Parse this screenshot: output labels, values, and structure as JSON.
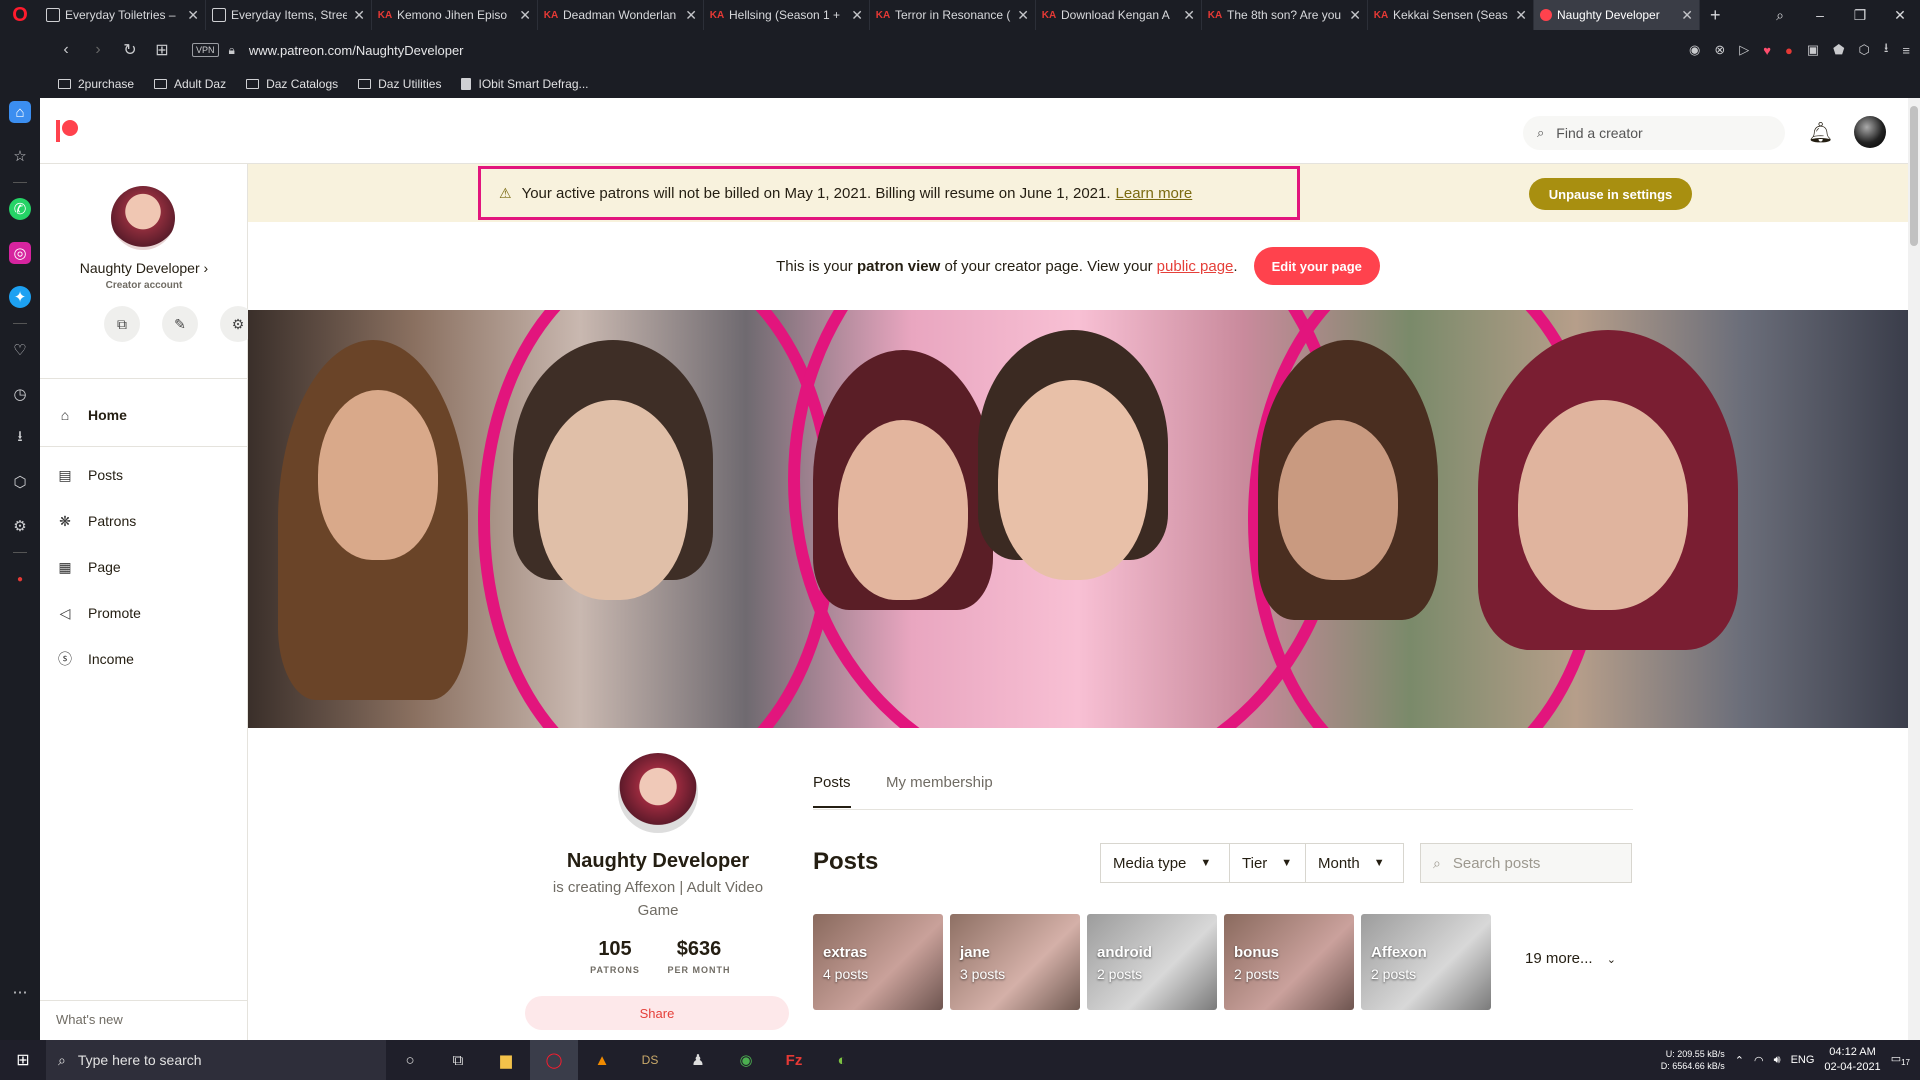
{
  "browser": {
    "tabs": [
      {
        "title": "Everyday Toiletries – ",
        "icon": "box-icon"
      },
      {
        "title": "Everyday Items, Stree",
        "icon": "box-icon"
      },
      {
        "title": "Kemono Jihen Episo",
        "icon": "ka-icon"
      },
      {
        "title": "Deadman Wonderlan",
        "icon": "ka-icon"
      },
      {
        "title": "Hellsing (Season 1 +",
        "icon": "ka-icon"
      },
      {
        "title": "Terror in Resonance (",
        "icon": "ka-icon"
      },
      {
        "title": "Download Kengan A",
        "icon": "ka-icon"
      },
      {
        "title": "The 8th son? Are you",
        "icon": "ka-icon"
      },
      {
        "title": "Kekkai Sensen (Seas",
        "icon": "ka-icon"
      },
      {
        "title": "Naughty Developer",
        "icon": "patreon-icon",
        "active": true
      }
    ],
    "url": "www.patreon.com/NaughtyDeveloper",
    "vpn": "VPN",
    "bookmarks": [
      "2purchase",
      "Adult Daz",
      "Daz Catalogs",
      "Daz Utilities",
      "IObit Smart Defrag..."
    ]
  },
  "patreon": {
    "search_placeholder": "Find a creator",
    "brand_color": "#ff424d",
    "creator": {
      "name": "Naughty Developer",
      "chevron": "›",
      "account_type": "Creator account"
    },
    "nav": [
      {
        "label": "Home",
        "icon": "home-icon"
      },
      {
        "label": "Posts",
        "icon": "posts-icon"
      },
      {
        "label": "Patrons",
        "icon": "patrons-icon"
      },
      {
        "label": "Page",
        "icon": "page-icon"
      },
      {
        "label": "Promote",
        "icon": "megaphone-icon"
      },
      {
        "label": "Income",
        "icon": "income-icon"
      }
    ],
    "whats_new": "What's new",
    "banner": {
      "message": "Your active patrons will not be billed on May 1, 2021. Billing will resume on June 1, 2021.",
      "link": "Learn more",
      "button": "Unpause in settings"
    },
    "patron_view": {
      "pre": "This is your",
      "bold": "patron view",
      "mid": "of your creator page. View your",
      "link": "public page",
      "post": ".",
      "button": "Edit your page"
    },
    "profile": {
      "name": "Naughty Developer",
      "description": "is creating Affexon | Adult Video Game",
      "patrons_value": "105",
      "patrons_label": "PATRONS",
      "income_value": "$636",
      "income_label": "PER MONTH",
      "share": "Share"
    },
    "tabs": [
      "Posts",
      "My membership"
    ],
    "posts_heading": "Posts",
    "filters": [
      "Media type",
      "Tier",
      "Month"
    ],
    "search_posts_placeholder": "Search posts",
    "collections": [
      {
        "name": "extras",
        "count": "4 posts"
      },
      {
        "name": "jane",
        "count": "3 posts"
      },
      {
        "name": "android",
        "count": "2 posts"
      },
      {
        "name": "bonus",
        "count": "2 posts"
      },
      {
        "name": "Affexon",
        "count": "2 posts"
      }
    ],
    "more": "19 more..."
  },
  "taskbar": {
    "search_placeholder": "Type here to search",
    "net_up": "209.55 kB/s",
    "net_down": "6564.66 kB/s",
    "net_up_label": "U:",
    "net_down_label": "D:",
    "lang": "ENG",
    "time": "04:12 AM",
    "date": "02-04-2021",
    "notif_count": "17"
  }
}
